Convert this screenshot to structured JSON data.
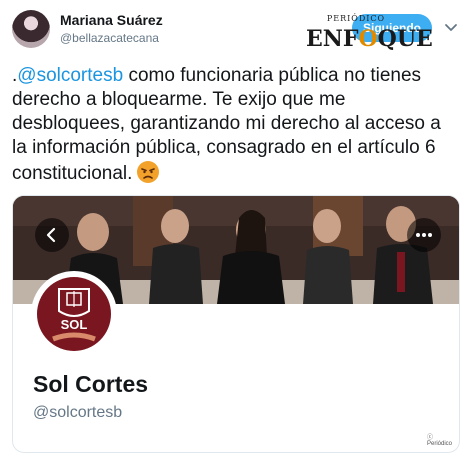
{
  "tweet": {
    "author": {
      "display_name": "Mariana Suárez",
      "handle": "@bellazacatecana"
    },
    "follow_label": "Siguiendo",
    "text_prefix": ".",
    "mention": "@solcortesb",
    "text_body": " como funcionaria pública no tienes derecho a bloquearme. Te exijo que me desbloquees, garantizando mi derecho al acceso a la información pública, consagrado en el artículo 6 constitucional.",
    "emoji": "angry-face-icon"
  },
  "logo": {
    "top_text": "PERIÓDICO",
    "main_before": "ENF",
    "main_o": "O",
    "main_after": "QUE"
  },
  "card": {
    "profile_label": "SOL",
    "name": "Sol Cortes",
    "handle": "@solcortesb",
    "watermark": "ⓒ Periódico"
  },
  "colors": {
    "accent": "#1da1f2",
    "mention": "#1b95e0",
    "profile_bg": "#7a1620",
    "logo_o": "#e08a00"
  }
}
